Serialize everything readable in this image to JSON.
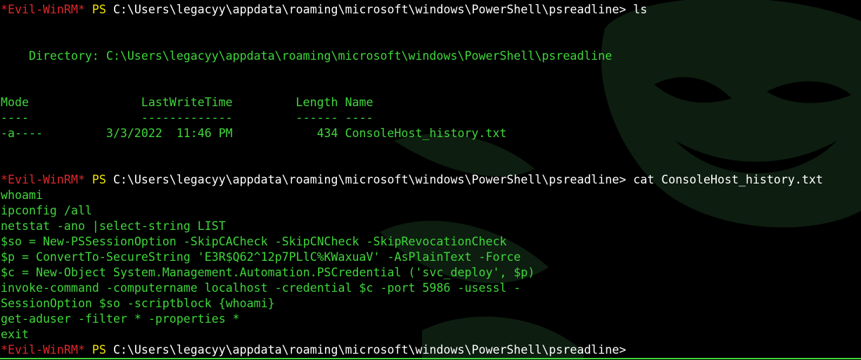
{
  "terminal": {
    "colors": {
      "background": "#000000",
      "output": "#3fd63a",
      "prompt_tag": "#e1262b",
      "prompt_ps": "#f2e400",
      "prompt_path": "#ffffff",
      "watermark": "#0d1d10"
    },
    "prompt": {
      "tag": "*Evil-WinRM*",
      "ps": "PS",
      "path": "C:\\Users\\legacyy\\appdata\\roaming\\microsoft\\windows\\PowerShell\\psreadline>"
    },
    "commands": [
      "ls",
      "cat ConsoleHost_history.txt"
    ],
    "listing": {
      "directory": "Directory: C:\\Users\\legacyy\\appdata\\roaming\\microsoft\\windows\\PowerShell\\psreadline",
      "headers": {
        "mode": "Mode",
        "last_write_time": "LastWriteTime",
        "length": "Length",
        "name": "Name"
      },
      "underlines": {
        "mode": "----",
        "last_write_time": "-------------",
        "length": "------",
        "name": "----"
      },
      "files": [
        {
          "mode": "-a----",
          "date": "3/3/2022",
          "time": "11:46 PM",
          "length": "434",
          "name": "ConsoleHost_history.txt"
        }
      ]
    },
    "history": [
      "whoami",
      "ipconfig /all",
      "netstat -ano |select-string LIST",
      "$so = New-PSSessionOption -SkipCACheck -SkipCNCheck -SkipRevocationCheck",
      "$p = ConvertTo-SecureString 'E3R$Q62^12p7PLlC%KWaxuaV' -AsPlainText -Force",
      "$c = New-Object System.Management.Automation.PSCredential ('svc_deploy', $p)",
      "invoke-command -computername localhost -credential $c -port 5986 -usessl -",
      "SessionOption $so -scriptblock {whoami}",
      "get-aduser -filter * -properties *",
      "exit"
    ]
  }
}
